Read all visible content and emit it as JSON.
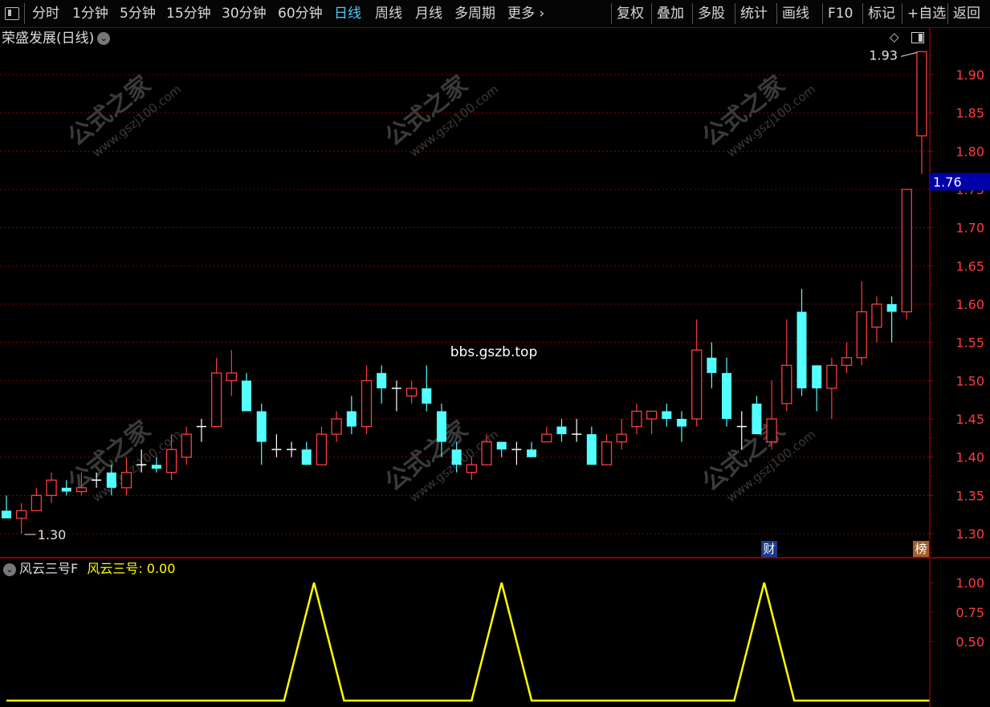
{
  "toolbar": {
    "periods": [
      "分时",
      "1分钟",
      "5分钟",
      "15分钟",
      "30分钟",
      "60分钟",
      "日线",
      "周线",
      "月线",
      "多周期",
      "更多"
    ],
    "more_arrow": "›",
    "active_period": "日线",
    "actions": [
      "复权",
      "叠加",
      "多股",
      "统计",
      "画线",
      "F10",
      "标记",
      "+自选",
      "返回"
    ]
  },
  "main": {
    "title": "荣盛发展(日线)",
    "watermark_url": "www.gszj100.com",
    "watermark_text": "公式之家",
    "center_text": "bbs.gszb.top",
    "badge_cai": "财",
    "badge_bang": "榜"
  },
  "indicator": {
    "name": "风云三号F",
    "value_label": "风云三号: 0.00"
  },
  "colors": {
    "up": "#ff3c3c",
    "down": "#54ffff",
    "doji": "#ffffff",
    "grid": "#8a0000",
    "axis_text": "#ff3c3c",
    "indicator_line": "#ffff00",
    "current_price_bg": "#0000a8"
  },
  "chart_data": [
    {
      "type": "candlestick",
      "title": "荣盛发展(日线)",
      "ylim": [
        1.27,
        1.96
      ],
      "y_ticks": [
        1.3,
        1.35,
        1.4,
        1.45,
        1.5,
        1.55,
        1.6,
        1.65,
        1.7,
        1.75,
        1.8,
        1.85,
        1.9
      ],
      "y_tick_labels": [
        "1.30",
        "1.35",
        "1.40",
        "1.45",
        "1.50",
        "1.55",
        "1.60",
        "1.65",
        "1.70",
        "1.75",
        "1.80",
        "1.85",
        "1.90"
      ],
      "current_price": "1.76",
      "max_annotation": "1.93",
      "min_annotation": "1.30",
      "candles": [
        {
          "o": 1.33,
          "h": 1.35,
          "l": 1.32,
          "c": 1.32
        },
        {
          "o": 1.32,
          "h": 1.34,
          "l": 1.3,
          "c": 1.33
        },
        {
          "o": 1.33,
          "h": 1.36,
          "l": 1.33,
          "c": 1.35
        },
        {
          "o": 1.35,
          "h": 1.38,
          "l": 1.34,
          "c": 1.37
        },
        {
          "o": 1.36,
          "h": 1.37,
          "l": 1.35,
          "c": 1.355
        },
        {
          "o": 1.355,
          "h": 1.38,
          "l": 1.35,
          "c": 1.36
        },
        {
          "o": 1.37,
          "h": 1.38,
          "l": 1.36,
          "c": 1.37
        },
        {
          "o": 1.38,
          "h": 1.39,
          "l": 1.35,
          "c": 1.36
        },
        {
          "o": 1.36,
          "h": 1.4,
          "l": 1.35,
          "c": 1.38
        },
        {
          "o": 1.39,
          "h": 1.41,
          "l": 1.38,
          "c": 1.39
        },
        {
          "o": 1.39,
          "h": 1.4,
          "l": 1.38,
          "c": 1.385
        },
        {
          "o": 1.38,
          "h": 1.43,
          "l": 1.37,
          "c": 1.41
        },
        {
          "o": 1.4,
          "h": 1.44,
          "l": 1.39,
          "c": 1.43
        },
        {
          "o": 1.44,
          "h": 1.45,
          "l": 1.42,
          "c": 1.44
        },
        {
          "o": 1.44,
          "h": 1.53,
          "l": 1.44,
          "c": 1.51
        },
        {
          "o": 1.5,
          "h": 1.54,
          "l": 1.48,
          "c": 1.51
        },
        {
          "o": 1.5,
          "h": 1.51,
          "l": 1.46,
          "c": 1.46
        },
        {
          "o": 1.46,
          "h": 1.47,
          "l": 1.39,
          "c": 1.42
        },
        {
          "o": 1.41,
          "h": 1.43,
          "l": 1.4,
          "c": 1.41
        },
        {
          "o": 1.41,
          "h": 1.42,
          "l": 1.4,
          "c": 1.41
        },
        {
          "o": 1.41,
          "h": 1.42,
          "l": 1.39,
          "c": 1.39
        },
        {
          "o": 1.39,
          "h": 1.44,
          "l": 1.39,
          "c": 1.43
        },
        {
          "o": 1.43,
          "h": 1.46,
          "l": 1.42,
          "c": 1.45
        },
        {
          "o": 1.46,
          "h": 1.48,
          "l": 1.43,
          "c": 1.44
        },
        {
          "o": 1.44,
          "h": 1.52,
          "l": 1.43,
          "c": 1.5
        },
        {
          "o": 1.51,
          "h": 1.52,
          "l": 1.47,
          "c": 1.49
        },
        {
          "o": 1.49,
          "h": 1.5,
          "l": 1.46,
          "c": 1.49
        },
        {
          "o": 1.48,
          "h": 1.5,
          "l": 1.47,
          "c": 1.49
        },
        {
          "o": 1.49,
          "h": 1.52,
          "l": 1.46,
          "c": 1.47
        },
        {
          "o": 1.46,
          "h": 1.47,
          "l": 1.4,
          "c": 1.42
        },
        {
          "o": 1.41,
          "h": 1.42,
          "l": 1.38,
          "c": 1.39
        },
        {
          "o": 1.38,
          "h": 1.4,
          "l": 1.37,
          "c": 1.39
        },
        {
          "o": 1.39,
          "h": 1.43,
          "l": 1.39,
          "c": 1.42
        },
        {
          "o": 1.42,
          "h": 1.42,
          "l": 1.4,
          "c": 1.41
        },
        {
          "o": 1.41,
          "h": 1.42,
          "l": 1.39,
          "c": 1.41
        },
        {
          "o": 1.41,
          "h": 1.42,
          "l": 1.4,
          "c": 1.4
        },
        {
          "o": 1.42,
          "h": 1.44,
          "l": 1.42,
          "c": 1.43
        },
        {
          "o": 1.44,
          "h": 1.45,
          "l": 1.42,
          "c": 1.43
        },
        {
          "o": 1.43,
          "h": 1.45,
          "l": 1.42,
          "c": 1.43
        },
        {
          "o": 1.43,
          "h": 1.44,
          "l": 1.39,
          "c": 1.39
        },
        {
          "o": 1.39,
          "h": 1.43,
          "l": 1.39,
          "c": 1.42
        },
        {
          "o": 1.42,
          "h": 1.45,
          "l": 1.41,
          "c": 1.43
        },
        {
          "o": 1.44,
          "h": 1.47,
          "l": 1.43,
          "c": 1.46
        },
        {
          "o": 1.45,
          "h": 1.46,
          "l": 1.43,
          "c": 1.46
        },
        {
          "o": 1.46,
          "h": 1.47,
          "l": 1.44,
          "c": 1.45
        },
        {
          "o": 1.45,
          "h": 1.46,
          "l": 1.42,
          "c": 1.44
        },
        {
          "o": 1.45,
          "h": 1.58,
          "l": 1.44,
          "c": 1.54
        },
        {
          "o": 1.53,
          "h": 1.55,
          "l": 1.49,
          "c": 1.51
        },
        {
          "o": 1.51,
          "h": 1.53,
          "l": 1.44,
          "c": 1.45
        },
        {
          "o": 1.44,
          "h": 1.46,
          "l": 1.41,
          "c": 1.44
        },
        {
          "o": 1.47,
          "h": 1.48,
          "l": 1.43,
          "c": 1.43
        },
        {
          "o": 1.42,
          "h": 1.5,
          "l": 1.41,
          "c": 1.45
        },
        {
          "o": 1.47,
          "h": 1.58,
          "l": 1.46,
          "c": 1.52
        },
        {
          "o": 1.59,
          "h": 1.62,
          "l": 1.48,
          "c": 1.49
        },
        {
          "o": 1.52,
          "h": 1.52,
          "l": 1.46,
          "c": 1.49
        },
        {
          "o": 1.49,
          "h": 1.53,
          "l": 1.45,
          "c": 1.52
        },
        {
          "o": 1.52,
          "h": 1.55,
          "l": 1.51,
          "c": 1.53
        },
        {
          "o": 1.53,
          "h": 1.63,
          "l": 1.52,
          "c": 1.59
        },
        {
          "o": 1.57,
          "h": 1.61,
          "l": 1.55,
          "c": 1.6
        },
        {
          "o": 1.6,
          "h": 1.61,
          "l": 1.55,
          "c": 1.59
        },
        {
          "o": 1.59,
          "h": 1.75,
          "l": 1.58,
          "c": 1.75
        },
        {
          "o": 1.82,
          "h": 1.93,
          "l": 1.77,
          "c": 1.93
        }
      ]
    },
    {
      "type": "line",
      "title": "风云三号F",
      "ylim": [
        0,
        1.1
      ],
      "y_ticks": [
        0.5,
        0.75,
        1.0
      ],
      "y_tick_labels": [
        "0.50",
        "0.75",
        "1.00"
      ],
      "series": [
        {
          "name": "风云三号",
          "x": [
            0,
            18.5,
            20.5,
            22.5,
            31,
            33,
            35,
            48.5,
            50.5,
            52.5,
            61.5
          ],
          "values": [
            0,
            0,
            1,
            0,
            0,
            1,
            0,
            0,
            1,
            0,
            0
          ]
        }
      ]
    }
  ]
}
